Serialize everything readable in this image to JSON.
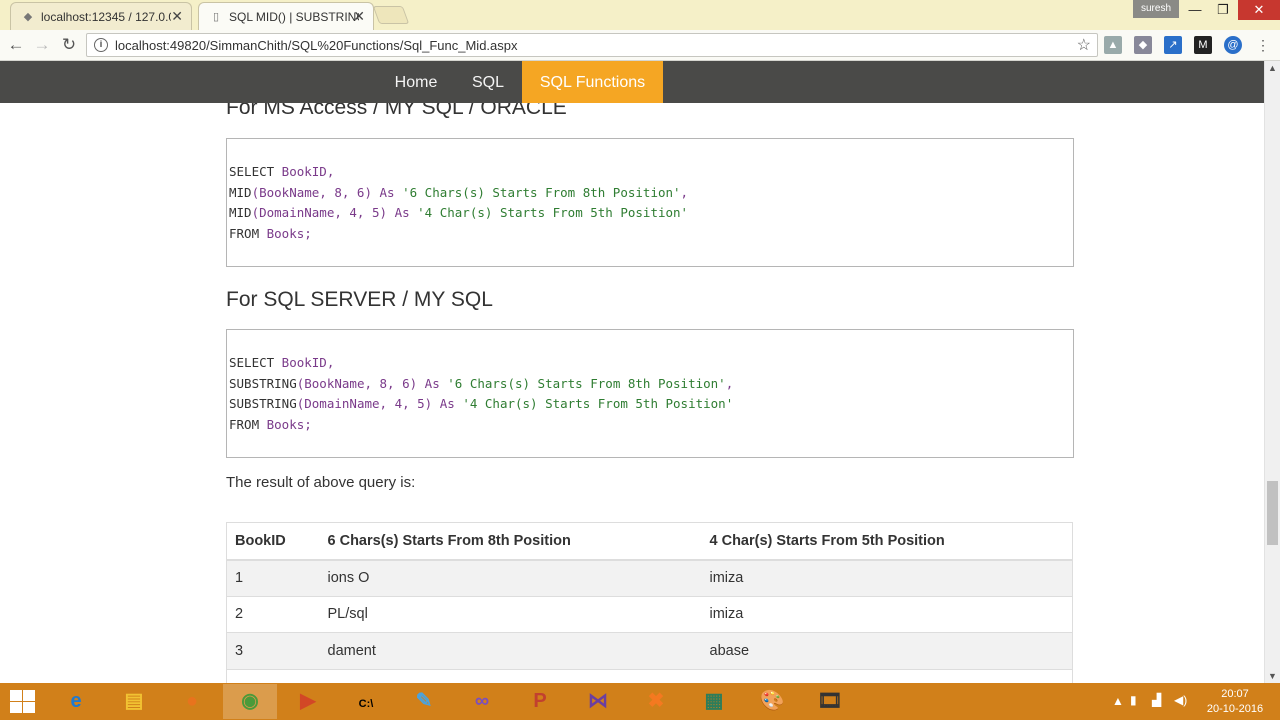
{
  "browser": {
    "tabs": [
      {
        "title": "localhost:12345 / 127.0.0",
        "icon": "phpmyadmin-icon",
        "active": false
      },
      {
        "title": "SQL MID() | SUBSTRING()",
        "icon": "page-icon",
        "active": true
      }
    ],
    "profile_name": "suresh",
    "url": "localhost:49820/SimmanChith/SQL%20Functions/Sql_Func_Mid.aspx",
    "window_controls": {
      "minimize": "—",
      "restore": "❐",
      "close": "✕"
    }
  },
  "site": {
    "nav": [
      {
        "label": "Home",
        "active": false
      },
      {
        "label": "SQL",
        "active": false
      },
      {
        "label": "SQL Functions",
        "active": true,
        "active_color": "#f5a623"
      }
    ],
    "nav_bg": "#4a4a48"
  },
  "content": {
    "heading_access": "For MS Access / MY SQL / ORACLE",
    "code_access": {
      "l1_kw": "SELECT",
      "l1_rest": " BookID,",
      "l2_fn": "MID",
      "l2_args": "(BookName, 8, 6) As ",
      "l2_str": "'6 Chars(s) Starts From 8th Position'",
      "l2_end": ",",
      "l3_fn": "MID",
      "l3_args": "(DomainName, 4, 5) As ",
      "l3_str": "'4 Char(s) Starts From 5th Position'",
      "l4_kw": "FROM",
      "l4_rest": " Books;"
    },
    "heading_sqlserver": "For SQL SERVER / MY SQL",
    "code_sqlserver": {
      "l1_kw": "SELECT",
      "l1_rest": " BookID,",
      "l2_fn": "SUBSTRING",
      "l2_args": "(BookName, 8, 6) As ",
      "l2_str": "'6 Chars(s) Starts From 8th Position'",
      "l2_end": ",",
      "l3_fn": "SUBSTRING",
      "l3_args": "(DomainName, 4, 5) As ",
      "l3_str": "'4 Char(s) Starts From 5th Position'",
      "l4_kw": "FROM",
      "l4_rest": " Books;"
    },
    "result_intro": "The result of above query is:",
    "table": {
      "headers": [
        "BookID",
        "6 Chars(s) Starts From 8th Position",
        "4 Char(s) Starts From 5th Position"
      ],
      "rows": [
        [
          "1",
          "ions O",
          "imiza"
        ],
        [
          "2",
          "PL/sql",
          "imiza"
        ],
        [
          "3",
          "dament",
          "abase"
        ]
      ]
    }
  },
  "taskbar": {
    "apps": [
      {
        "name": "internet-explorer-icon",
        "glyph": "e"
      },
      {
        "name": "file-explorer-icon",
        "glyph": "▤"
      },
      {
        "name": "firefox-icon",
        "glyph": "●"
      },
      {
        "name": "chrome-icon",
        "glyph": "◉"
      },
      {
        "name": "media-player-icon",
        "glyph": "▶"
      },
      {
        "name": "command-prompt-icon",
        "glyph": "C:\\"
      },
      {
        "name": "notepad-icon",
        "glyph": "✎"
      },
      {
        "name": "visual-studio-code-icon",
        "glyph": "∞"
      },
      {
        "name": "powerpoint-icon",
        "glyph": "P"
      },
      {
        "name": "visual-studio-icon",
        "glyph": "⋈"
      },
      {
        "name": "xampp-icon",
        "glyph": "✖"
      },
      {
        "name": "document-icon",
        "glyph": "▦"
      },
      {
        "name": "paint-icon",
        "glyph": "🎨"
      },
      {
        "name": "movie-maker-icon",
        "glyph": "🎞"
      }
    ],
    "time": "20:07",
    "date": "20-10-2016"
  }
}
